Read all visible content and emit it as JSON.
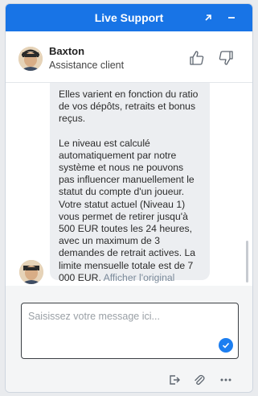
{
  "header": {
    "title": "Live Support",
    "popout_icon": "arrow-up-right-icon",
    "minimize_icon": "minimize-icon",
    "bg_color": "#1874e6"
  },
  "agent": {
    "name": "Baxton",
    "role": "Assistance client",
    "rate_up_icon": "thumbs-up-icon",
    "rate_down_icon": "thumbs-down-icon"
  },
  "messages": [
    {
      "sender": "agent",
      "paragraphs": [
        "Elles varient en fonction du ratio de vos dépôts, retraits et bonus reçus.",
        "Le niveau est calculé automatiquement par notre système et nous ne pouvons pas influencer manuellement le statut du compte d'un joueur. Votre statut actuel (Niveau 1) vous permet de retirer jusqu'à 500 EUR toutes les 24 heures, avec un maximum de 3 demandes de retrait actives. La limite mensuelle totale est de 7 000 EUR."
      ],
      "show_original": "Afficher l'original"
    }
  ],
  "composer": {
    "placeholder": "Saisissez votre message ici...",
    "value": "",
    "send_icon": "check-send-icon",
    "accent": "#1c7ef0"
  },
  "toolbar": {
    "icons": [
      "exit-icon",
      "paperclip-icon",
      "more-icon"
    ]
  }
}
